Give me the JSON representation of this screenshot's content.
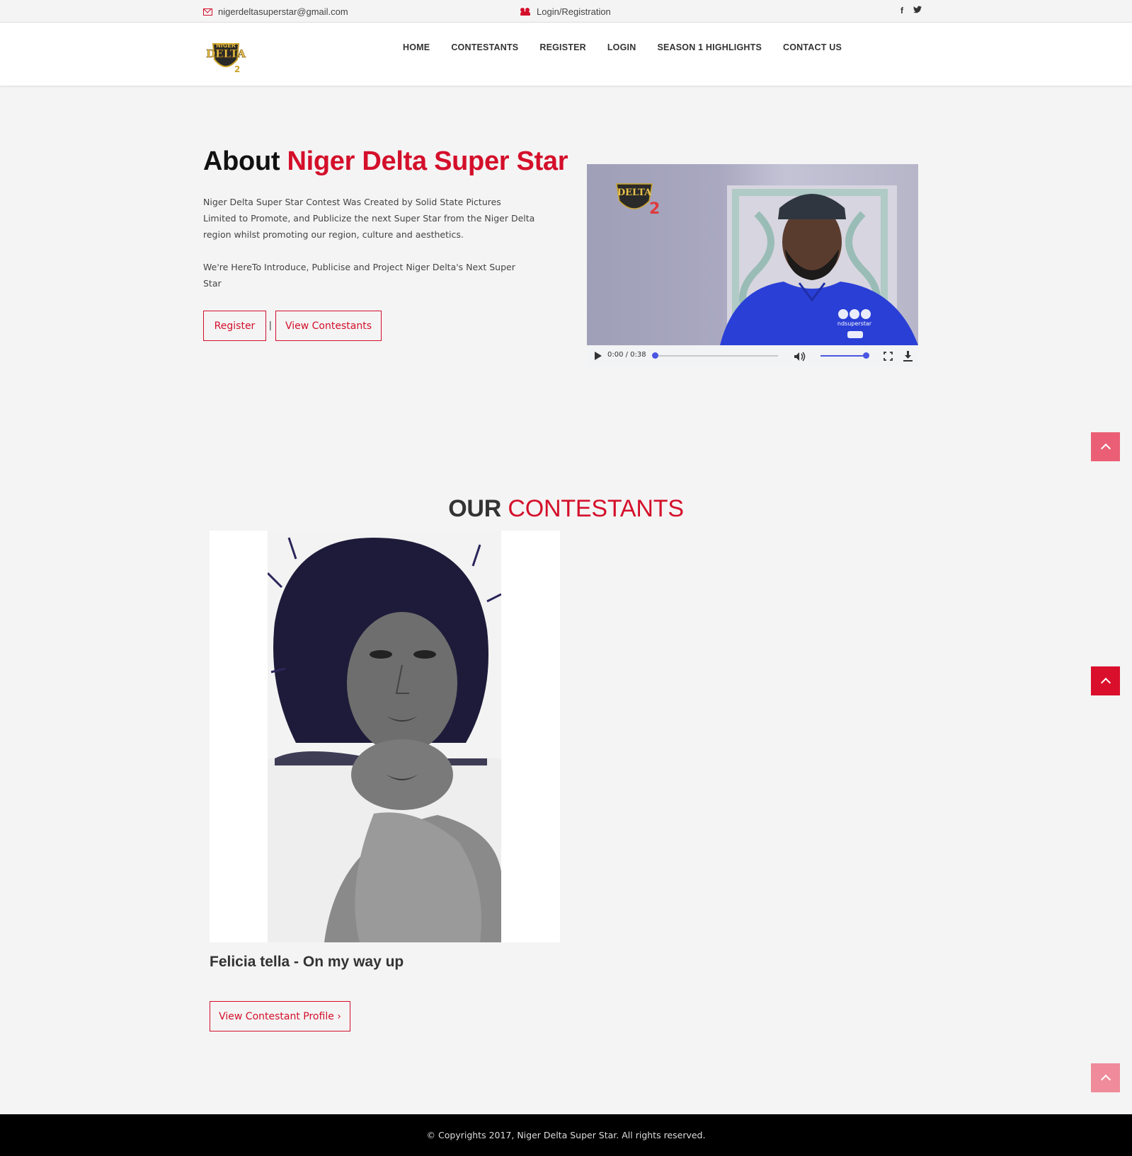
{
  "topbar": {
    "email": "nigerdeltasuperstar@gmail.com",
    "login": "Login/Registration",
    "social": {
      "facebook": "f",
      "twitter": "t"
    }
  },
  "nav": {
    "items": [
      "HOME",
      "CONTESTANTS",
      "REGISTER",
      "LOGIN",
      "SEASON 1 HIGHLIGHTS",
      "CONTACT US"
    ]
  },
  "about": {
    "title_prefix": "About",
    "title_highlight": "Niger Delta Super Star",
    "paragraph1": "Niger Delta Super Star Contest Was Created by Solid State Pictures Limited to Promote, and Publicize the next Super Star from the Niger Delta region whilst promoting our region, culture and aesthetics.",
    "paragraph2": "We're HereTo Introduce, Publicise and Project Niger Delta's Next Super Star",
    "register_label": "Register",
    "separator": "|",
    "view_label": "View Contestants"
  },
  "video": {
    "time": "0:00 / 0:38",
    "overlay_handle": "ndsuperstar",
    "progress": 0,
    "volume": 1
  },
  "contestants": {
    "title_prefix": "OUR",
    "title_highlight": "CONTESTANTS",
    "items": [
      {
        "title": "Felicia tella - On my way up",
        "button_label": "View Contestant Profile ›"
      }
    ]
  },
  "footer": {
    "copyright": "© Copyrights 2017, Niger Delta Super Star. All rights reserved."
  },
  "colors": {
    "accent": "#d40f2a",
    "background": "#f4f4f4",
    "footer": "#000000"
  }
}
